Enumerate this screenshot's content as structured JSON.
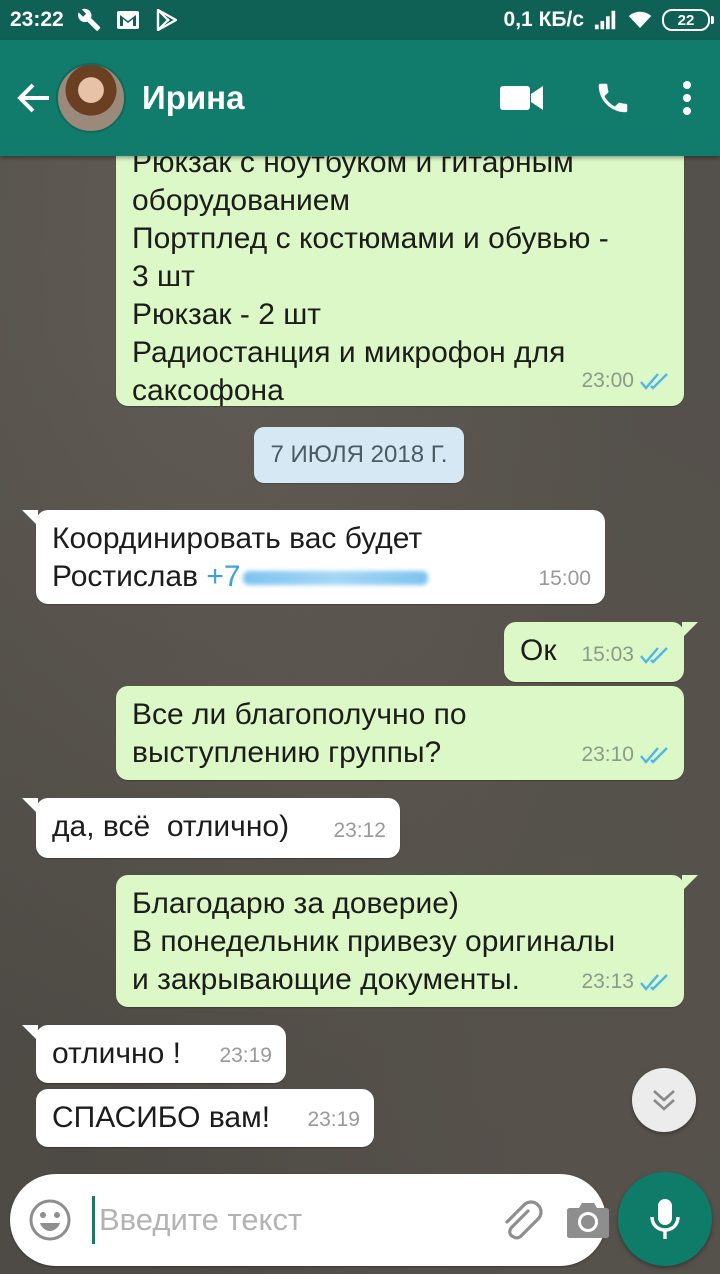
{
  "status_bar": {
    "time": "23:22",
    "network_speed": "0,1 КБ/с",
    "battery": "22",
    "icons": [
      "wrench-icon",
      "gmail-icon",
      "play-store-icon",
      "signal-icon",
      "wifi-icon",
      "battery-icon"
    ]
  },
  "header": {
    "contact_name": "Ирина",
    "icons": [
      "back-arrow-icon",
      "video-call-icon",
      "phone-call-icon",
      "more-vert-icon"
    ]
  },
  "messages": [
    {
      "direction": "out",
      "text": "Рюкзак с ноутбуком и гитарным\nоборудованием\nПортплед с костюмами и обувью -\n3 шт\nРюкзак - 2 шт\nРадиостанция и микрофон для\nсаксофона",
      "time": "23:00",
      "status": "read"
    },
    {
      "direction": "in",
      "text": "Координировать вас будет\nРостислав ",
      "phone": "+7",
      "time": "15:00"
    },
    {
      "direction": "out",
      "text": "Ок",
      "time": "15:03",
      "status": "read"
    },
    {
      "direction": "out",
      "text": "Все ли благополучно по\nвыступлению группы?",
      "time": "23:10",
      "status": "read"
    },
    {
      "direction": "in",
      "text": "да, всё  отлично)",
      "time": "23:12"
    },
    {
      "direction": "out",
      "text": "Благодарю за доверие)\nВ понедельник привезу оригиналы\nи закрывающие документы.",
      "time": "23:13",
      "status": "read"
    },
    {
      "direction": "in",
      "text": "отлично !",
      "time": "23:19"
    },
    {
      "direction": "in",
      "text": "СПАСИБО вам!",
      "time": "23:19"
    }
  ],
  "date_divider": "7 ИЮЛЯ 2018 Г.",
  "input": {
    "placeholder": "Введите текст",
    "value": ""
  },
  "colors": {
    "header": "#127c6c",
    "status_bar": "#0f6156",
    "outgoing_bubble": "#dcf8c6",
    "incoming_bubble": "#ffffff",
    "read_ticks": "#4fb6ec",
    "mic_button": "#0f7c69"
  }
}
